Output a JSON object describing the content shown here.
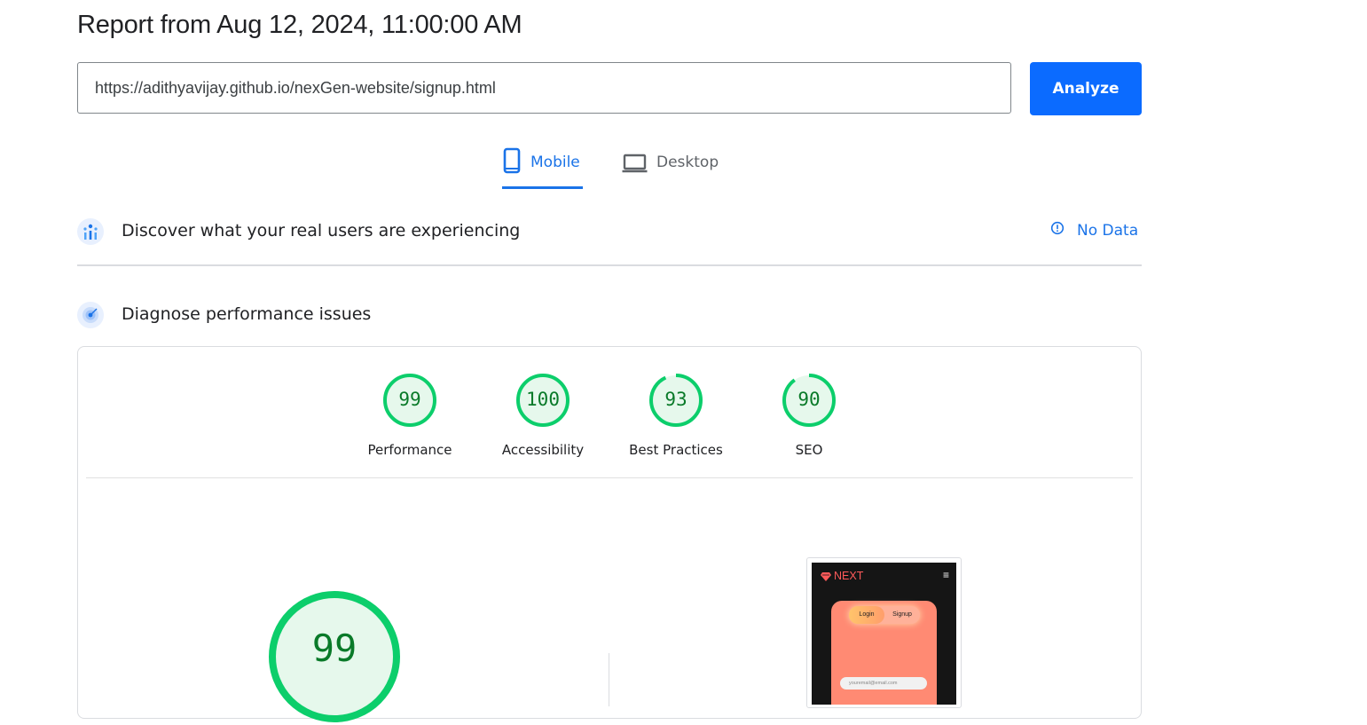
{
  "header": {
    "report_title": "Report from Aug 12, 2024, 11:00:00 AM",
    "url_value": "https://adithyavijay.github.io/nexGen-website/signup.html",
    "analyze_label": "Analyze"
  },
  "tabs": [
    {
      "label": "Mobile",
      "icon": "phone-icon",
      "selected": true
    },
    {
      "label": "Desktop",
      "icon": "laptop-icon",
      "selected": false
    }
  ],
  "field_data": {
    "title": "Discover what your real users are experiencing",
    "status": "No Data",
    "icon": "users-chart-icon"
  },
  "diagnose": {
    "title": "Diagnose performance issues",
    "icon": "speed-gauge-icon"
  },
  "scores": [
    {
      "label": "Performance",
      "value": "99"
    },
    {
      "label": "Accessibility",
      "value": "100"
    },
    {
      "label": "Best Practices",
      "value": "93"
    },
    {
      "label": "SEO",
      "value": "90"
    }
  ],
  "main_score": "99",
  "screenshot_preview": {
    "brand": "NEXT",
    "login": "Login",
    "signup": "Signup",
    "email_placeholder": "youremail@email.com"
  },
  "colors": {
    "accent": "#1a73e8",
    "button": "#0b6bff",
    "pass_green": "#0cce6b",
    "pass_text": "#0a7a29",
    "pass_fill": "#e6f8ec"
  }
}
